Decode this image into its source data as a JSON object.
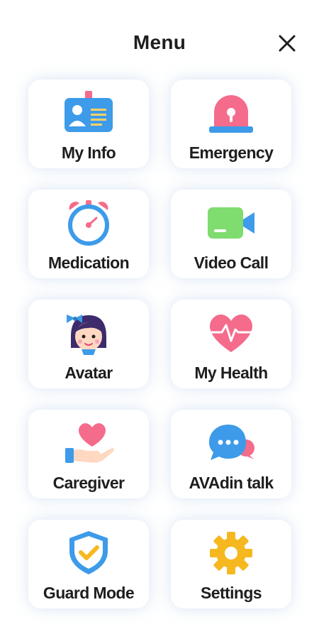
{
  "header": {
    "title": "Menu",
    "close_icon": "close-icon"
  },
  "menu": {
    "items": [
      {
        "label": "My Info",
        "icon": "id-card-icon"
      },
      {
        "label": "Emergency",
        "icon": "siren-icon"
      },
      {
        "label": "Medication",
        "icon": "alarm-clock-icon"
      },
      {
        "label": "Video Call",
        "icon": "video-camera-icon"
      },
      {
        "label": "Avatar",
        "icon": "girl-avatar-icon"
      },
      {
        "label": "My Health",
        "icon": "heart-pulse-icon"
      },
      {
        "label": "Caregiver",
        "icon": "heart-hand-icon"
      },
      {
        "label": "AVAdin talk",
        "icon": "chat-bubble-icon"
      },
      {
        "label": "Guard Mode",
        "icon": "shield-check-icon"
      },
      {
        "label": "Settings",
        "icon": "gear-icon"
      }
    ]
  },
  "colors": {
    "blue": "#3d9be9",
    "pink": "#f56b8c",
    "green": "#7fdc6e",
    "yellow": "#f5b81f",
    "text": "#1e1e1e"
  }
}
